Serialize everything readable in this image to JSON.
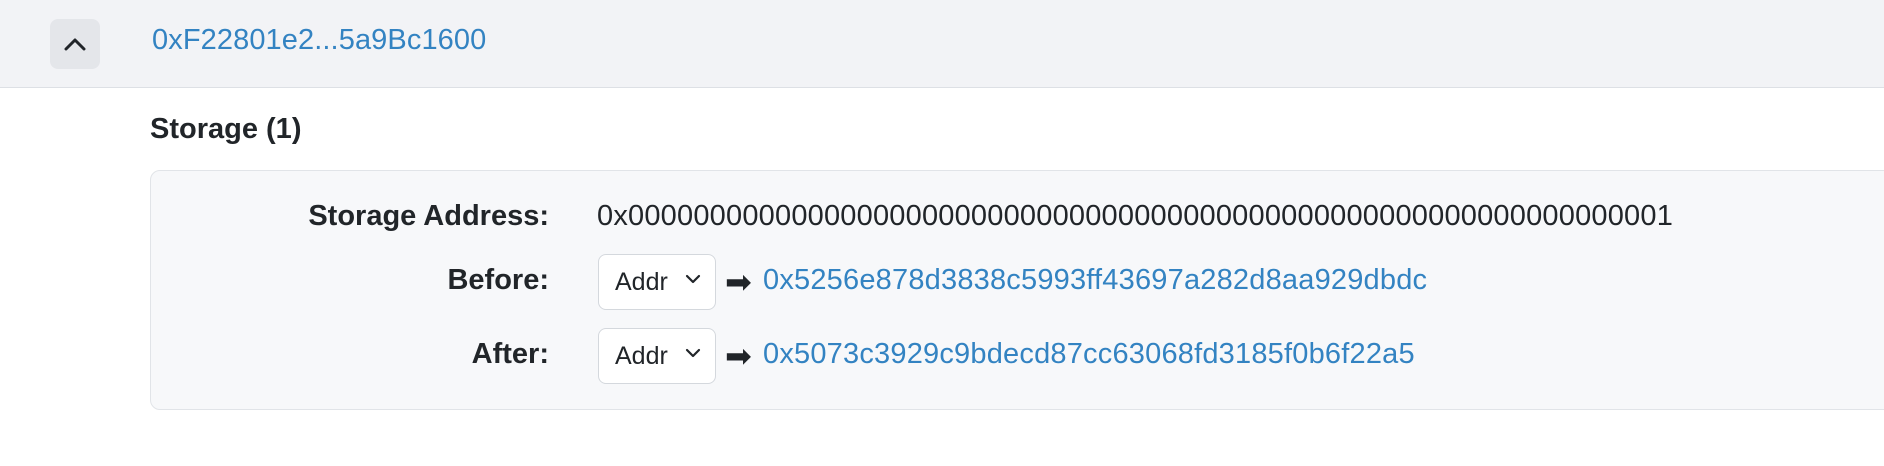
{
  "header": {
    "address": "0xF22801e2...5a9Bc1600"
  },
  "storage": {
    "title": "Storage (1)",
    "address_label": "Storage Address:",
    "address_value": "0x0000000000000000000000000000000000000000000000000000000000000001",
    "before_label": "Before:",
    "before_type": "Addr",
    "before_value": "0x5256e878d3838c5993ff43697a282d8aa929dbdc",
    "after_label": "After:",
    "after_type": "Addr",
    "after_value": "0x5073c3929c9bdecd87cc63068fd3185f0b6f22a5",
    "arrow": "➡"
  },
  "icons": {
    "collapse": "chevron-up-icon",
    "dropdown": "chevron-down-icon"
  },
  "colors": {
    "link": "#3383c2",
    "header_bg": "#f2f3f6",
    "card_bg": "#f7f8fa"
  }
}
